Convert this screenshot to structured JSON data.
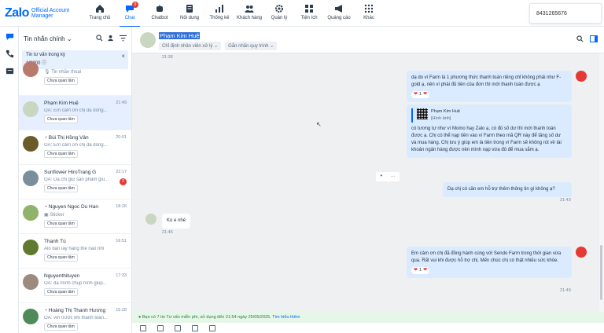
{
  "brand": {
    "name": "Zalo",
    "subtitle_line1": "Official Account",
    "subtitle_line2": "Manager",
    "accent": "#0068ff"
  },
  "nav": [
    {
      "label": "Trang chủ",
      "icon": "home-icon"
    },
    {
      "label": "Chat",
      "icon": "chat-icon",
      "badge": "9",
      "active": true
    },
    {
      "label": "Chatbot",
      "icon": "bot-icon"
    },
    {
      "label": "Nội dung",
      "icon": "document-icon"
    },
    {
      "label": "Thống kê",
      "icon": "chart-icon"
    },
    {
      "label": "Khách hàng",
      "icon": "users-icon"
    },
    {
      "label": "Quản lý",
      "icon": "gear-icon"
    },
    {
      "label": "Tiện ích",
      "icon": "puzzle-icon"
    },
    {
      "label": "Quảng cáo",
      "icon": "megaphone-icon"
    },
    {
      "label": "Khác",
      "icon": "grid-icon"
    }
  ],
  "phone_popup": "8431265676",
  "list": {
    "filter_label": "Tin nhắn chính",
    "notice_title": "Tin tư vấn trong kỳ",
    "notice_count": "1/9000",
    "conversations": [
      {
        "name": "",
        "msg": "Tin nhắn thoại",
        "tag": "Chưa quan tâm",
        "time": "",
        "unread": ""
      },
      {
        "name": "Phạm Kim Huệ",
        "msg": "OA: Em cảm ơn chị đã đồng...",
        "tag": "Chưa quan tâm",
        "time": "21:49",
        "unread": "",
        "active": true
      },
      {
        "name": "Bùi Thị Hồng Vân",
        "msg": "OA: Em cảm ơn chị đã đồng...",
        "tag": "Chưa quan tâm",
        "time": "20:01",
        "unread": ""
      },
      {
        "name": "Sunflower HiroTrang G",
        "msg": "OA: Dạ chị giữ sản phẩm giú...",
        "tag": "Chưa quan tâm",
        "time": "22:17",
        "unread": "2"
      },
      {
        "name": "Nguyen Ngoc Du Han",
        "msg": "Sticker",
        "tag": "Chưa quan tâm",
        "time": "18:26",
        "unread": ""
      },
      {
        "name": "Thanh Tú",
        "msg": "Alô bạn lấy hàng thế nào nhỉ",
        "tag": "Chưa quan tâm",
        "time": "16:51",
        "unread": ""
      },
      {
        "name": "Nguyenthituyen",
        "msg": "OA: dạ mình chụp hình giúp...",
        "tag": "Chưa quan tâm",
        "time": "17:33",
        "unread": ""
      },
      {
        "name": "Hoàng Thị Thanh Hương",
        "msg": "OA: với trước khi thanh toán...",
        "tag": "Chưa quan tâm",
        "time": "15:28",
        "unread": ""
      }
    ]
  },
  "chat": {
    "contact_name": "Phạm Kim Huệ",
    "assign_chip": "Chỉ định nhân viên xử lý",
    "process_chip": "Gắn nhãn quy trình",
    "time_top": "21:38",
    "msg1": "dạ do ví Farm là 1 phương thức thanh toán riêng chỉ không phải như F-gold ạ, nên ví phải đủ tiền của đơn thì mới thanh toán được ạ",
    "msg1_react": "1",
    "quote_name": "Phạm Kim Huệ",
    "quote_text": "[Hình ảnh]",
    "msg2": "có tương tự như ví Momo hay Zalo ạ, có đủ số dư thì mới thanh toán được ạ. Chị có thể nạp tiền vào ví Farm theo mã QR này để tăng số dư và mua hàng. Chị lưu ý giúp em là tiền trong ví Farm sẽ không rút về tài khoản ngân hàng được nên mình nạp vừa đủ để mua sắm ạ.",
    "msg3": "Dạ chị có cần em hỗ trợ thêm thông tin gì không ạ?",
    "time3": "21:43",
    "incoming": "Ko e nhé",
    "time_in": "21:46",
    "msg4": "Em cảm ơn chị đã đồng hành cùng với Sendo Farm trong thời gian vừa qua. Rất vui khi được hỗ trợ chị. Mến chúc chị có thật nhiều sức khỏe.",
    "msg4_react": "1",
    "time4": "21:49"
  },
  "footer": {
    "text": "Bạn có 7 tin Tư vấn miễn phí, sử dụng đến 21:54 ngày 25/05/2025.",
    "link": "Tìm hiểu thêm"
  }
}
